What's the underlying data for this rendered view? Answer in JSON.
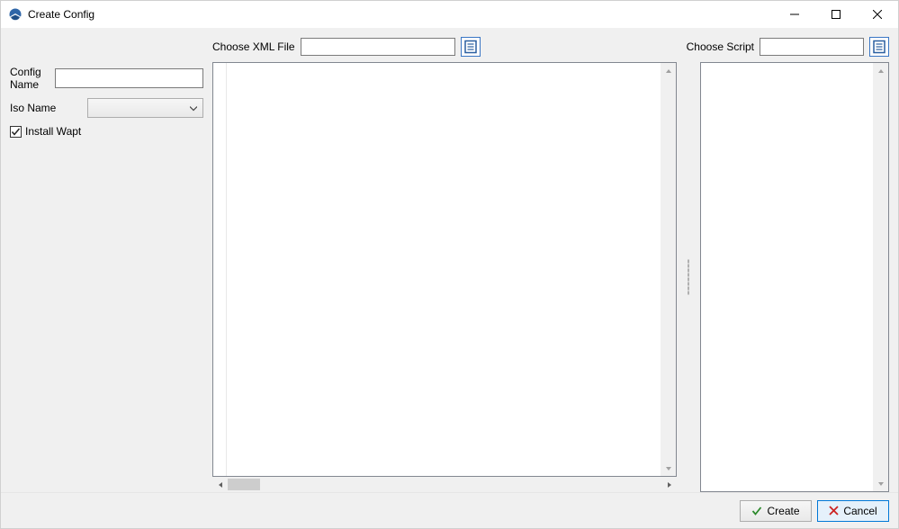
{
  "window": {
    "title": "Create Config"
  },
  "choosers": {
    "xml_label": "Choose XML File",
    "xml_value": "",
    "script_label": "Choose Script",
    "script_value": ""
  },
  "form": {
    "config_name_label": "Config Name",
    "config_name_value": "",
    "iso_name_label": "Iso Name",
    "iso_name_value": "",
    "install_wapt_label": "Install Wapt",
    "install_wapt_checked": true
  },
  "main": {
    "text_value": "",
    "side_text_value": ""
  },
  "footer": {
    "create_label": "Create",
    "cancel_label": "Cancel"
  },
  "icons": {
    "app": "globe-icon",
    "browse": "document-icon",
    "check": "check-icon",
    "create": "check-green-icon",
    "cancel": "close-red-icon"
  }
}
